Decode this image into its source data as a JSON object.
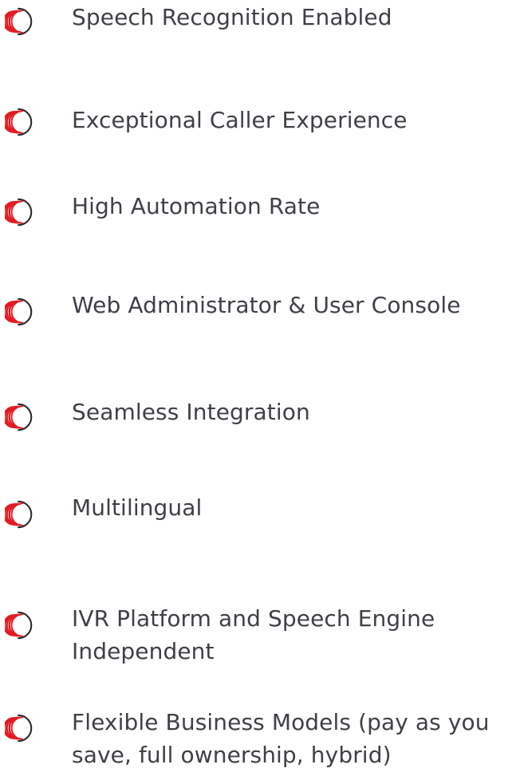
{
  "features": {
    "icon_name": "brand-swirl-icon",
    "icon_colors": {
      "primary": "#e31b23",
      "ring": "#2b2b2b"
    },
    "text_color": "#3f3f47",
    "items": [
      {
        "label": "Speech Recognition Enabled"
      },
      {
        "label": "Exceptional Caller Experience"
      },
      {
        "label": "High Automation Rate"
      },
      {
        "label": "Web Administrator & User Console"
      },
      {
        "label": "Seamless Integration"
      },
      {
        "label": "Multilingual"
      },
      {
        "label": "IVR Platform and Speech Engine Independent"
      },
      {
        "label": "Flexible Business Models (pay as you save, full ownership, hybrid)"
      }
    ]
  }
}
